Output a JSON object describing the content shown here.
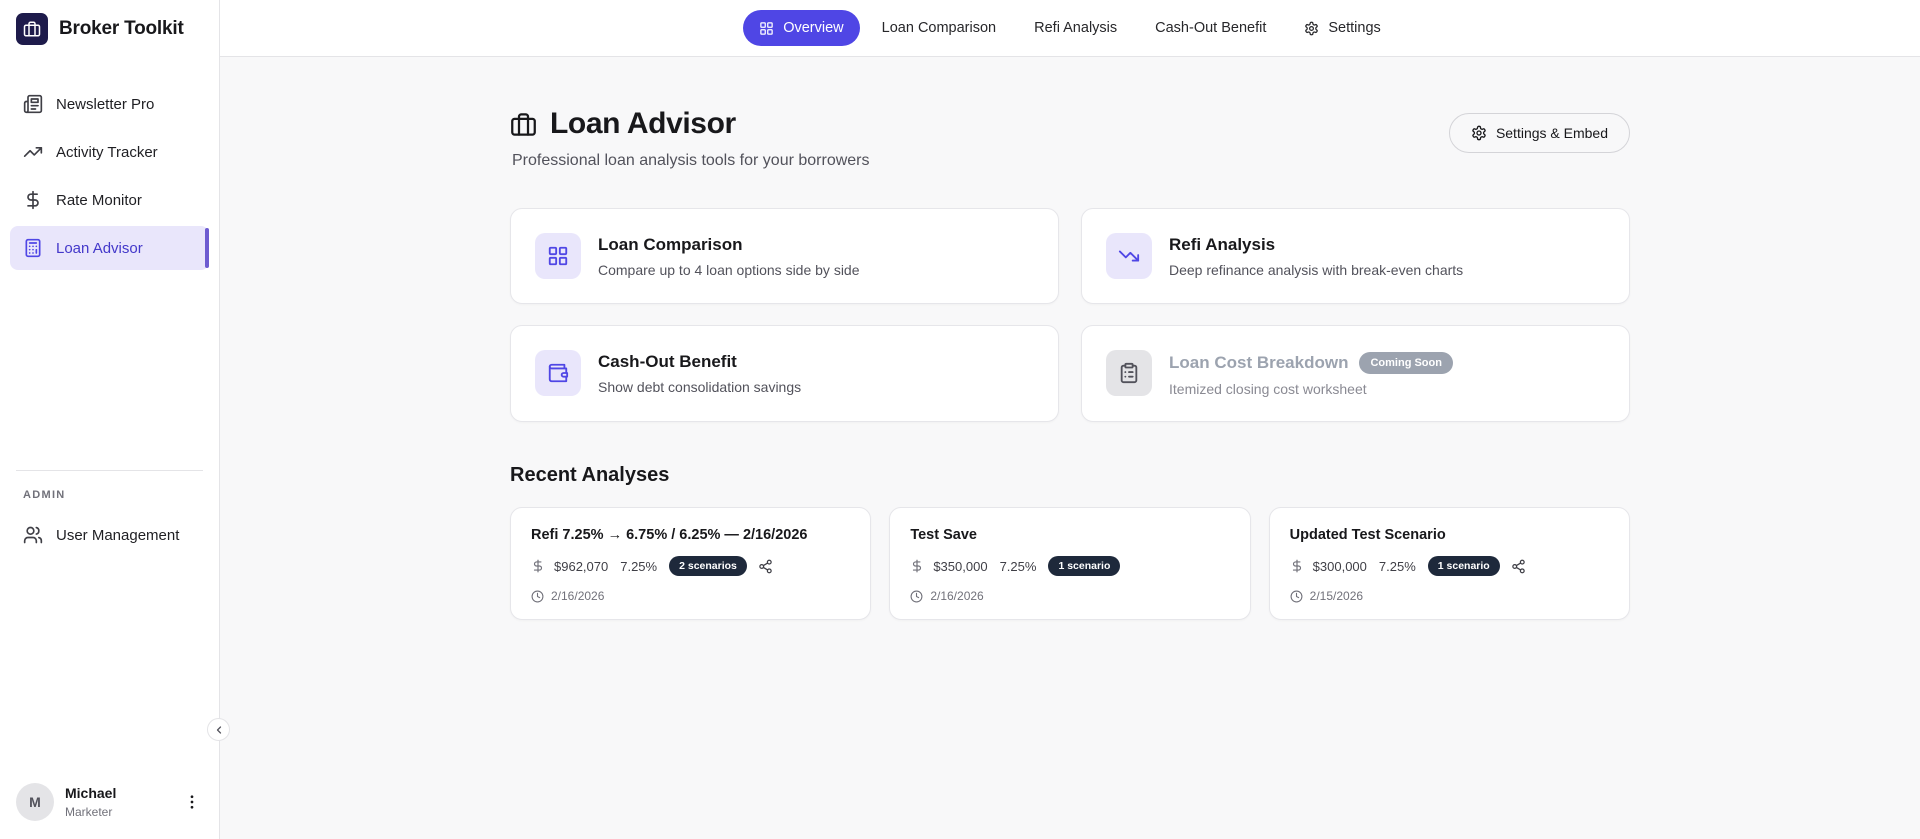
{
  "app": {
    "name": "Broker Toolkit"
  },
  "sidebar": {
    "items": [
      {
        "label": "Newsletter Pro",
        "icon": "newspaper-icon"
      },
      {
        "label": "Activity Tracker",
        "icon": "trending-up-icon"
      },
      {
        "label": "Rate Monitor",
        "icon": "dollar-icon"
      },
      {
        "label": "Loan Advisor",
        "icon": "calculator-icon",
        "active": true
      }
    ],
    "admin_label": "ADMIN",
    "admin_items": [
      {
        "label": "User Management",
        "icon": "users-icon"
      }
    ],
    "user": {
      "initial": "M",
      "name": "Michael",
      "role": "Marketer"
    }
  },
  "nav": {
    "tabs": [
      {
        "label": "Overview",
        "icon": "grid-icon",
        "active": true
      },
      {
        "label": "Loan Comparison"
      },
      {
        "label": "Refi Analysis"
      },
      {
        "label": "Cash-Out Benefit"
      },
      {
        "label": "Settings",
        "icon": "gear-icon"
      }
    ]
  },
  "page": {
    "title": "Loan Advisor",
    "subtitle": "Professional loan analysis tools for your borrowers",
    "settings_button": "Settings & Embed"
  },
  "features": [
    {
      "title": "Loan Comparison",
      "description": "Compare up to 4 loan options side by side",
      "icon": "grid-icon"
    },
    {
      "title": "Refi Analysis",
      "description": "Deep refinance analysis with break-even charts",
      "icon": "trending-down-icon"
    },
    {
      "title": "Cash-Out Benefit",
      "description": "Show debt consolidation savings",
      "icon": "wallet-icon"
    },
    {
      "title": "Loan Cost Breakdown",
      "description": "Itemized closing cost worksheet",
      "icon": "clipboard-icon",
      "disabled": true,
      "badge": "Coming Soon"
    }
  ],
  "recent": {
    "heading": "Recent Analyses",
    "items": [
      {
        "title": "Refi 7.25% → 6.75% / 6.25% — 2/16/2026",
        "amount": "$962,070",
        "rate": "7.25%",
        "badge": "2 scenarios",
        "date": "2/16/2026",
        "share": true
      },
      {
        "title": "Test Save",
        "amount": "$350,000",
        "rate": "7.25%",
        "badge": "1 scenario",
        "date": "2/16/2026",
        "share": false
      },
      {
        "title": "Updated Test Scenario",
        "amount": "$300,000",
        "rate": "7.25%",
        "badge": "1 scenario",
        "date": "2/15/2026",
        "share": true
      }
    ]
  },
  "colors": {
    "accent": "#4f46e5",
    "accent_light": "#e9e6fb",
    "badge_dark": "#1e293b",
    "coming_soon": "#9ca3af",
    "content_bg": "#f8f8f9"
  }
}
